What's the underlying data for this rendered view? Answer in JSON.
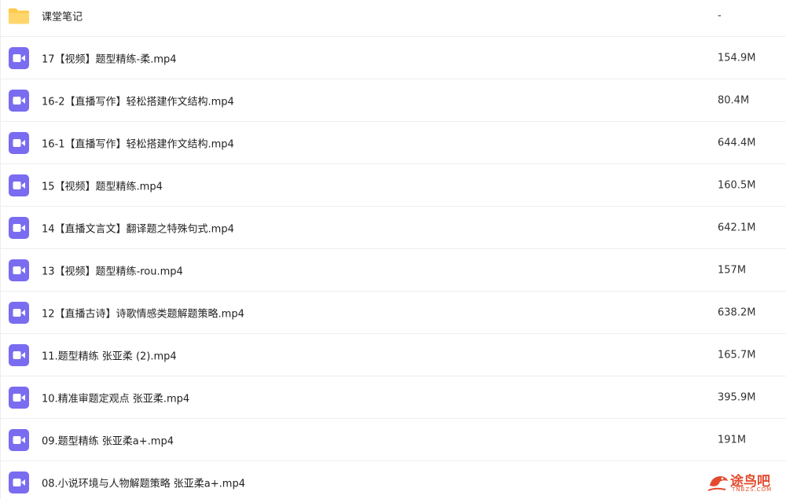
{
  "files": [
    {
      "name": "课堂笔记",
      "size": "-",
      "icon": "folder-icon"
    },
    {
      "name": "17【视频】题型精练-柔.mp4",
      "size": "154.9M",
      "icon": "video-file-icon"
    },
    {
      "name": "16-2【直播写作】轻松搭建作文结构.mp4",
      "size": "80.4M",
      "icon": "video-file-icon"
    },
    {
      "name": "16-1【直播写作】轻松搭建作文结构.mp4",
      "size": "644.4M",
      "icon": "video-file-icon"
    },
    {
      "name": "15【视频】题型精练.mp4",
      "size": "160.5M",
      "icon": "video-file-icon"
    },
    {
      "name": "14【直播文言文】翻译题之特殊句式.mp4",
      "size": "642.1M",
      "icon": "video-file-icon"
    },
    {
      "name": "13【视频】题型精练-rou.mp4",
      "size": "157M",
      "icon": "video-file-icon"
    },
    {
      "name": "12【直播古诗】诗歌情感类题解题策略.mp4",
      "size": "638.2M",
      "icon": "video-file-icon"
    },
    {
      "name": "11.题型精练 张亚柔 (2).mp4",
      "size": "165.7M",
      "icon": "video-file-icon"
    },
    {
      "name": "10.精准审题定观点 张亚柔.mp4",
      "size": "395.9M",
      "icon": "video-file-icon"
    },
    {
      "name": "09.题型精练 张亚柔a+.mp4",
      "size": "191M",
      "icon": "video-file-icon"
    },
    {
      "name": "08.小说环境与人物解题策略 张亚柔a+.mp4",
      "size": "",
      "icon": "video-file-icon"
    }
  ],
  "watermark": {
    "text": "途鸟吧",
    "subtext": "TNBZS.COM"
  },
  "colors": {
    "folder": "#FFC94A",
    "video_icon": "#7A6CF0",
    "watermark": "#E34B2E"
  }
}
